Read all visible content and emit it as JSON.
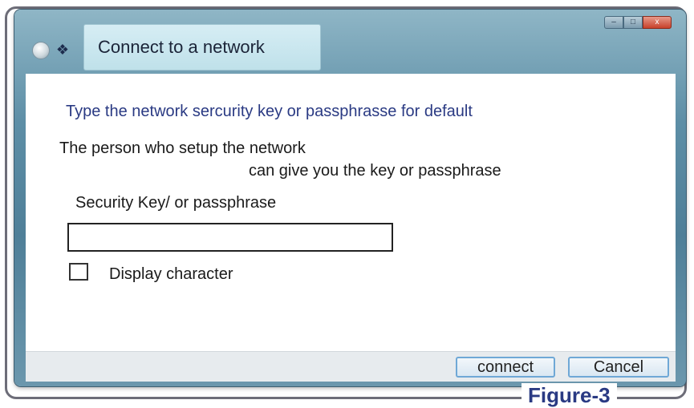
{
  "window": {
    "title": "Connect to a network",
    "controls": {
      "minimize": "–",
      "maximize": "□",
      "close": "x"
    }
  },
  "content": {
    "heading": "Type the network sercurity key or passphrasse for default",
    "description_line1": "The person who setup the network",
    "description_line2": "can give you the key or passphrase",
    "field_label": "Security Key/ or passphrase",
    "key_value": "",
    "checkbox_label": "Display character",
    "checkbox_checked": false
  },
  "buttons": {
    "connect": "connect",
    "cancel": "Cancel"
  },
  "caption": "Figure-3",
  "icons": {
    "back": "back-arrow-icon",
    "network": "network-icon"
  },
  "colors": {
    "heading": "#2a3a83",
    "titlebar": "#5d8ea6",
    "button_border": "#6fa8d6"
  }
}
